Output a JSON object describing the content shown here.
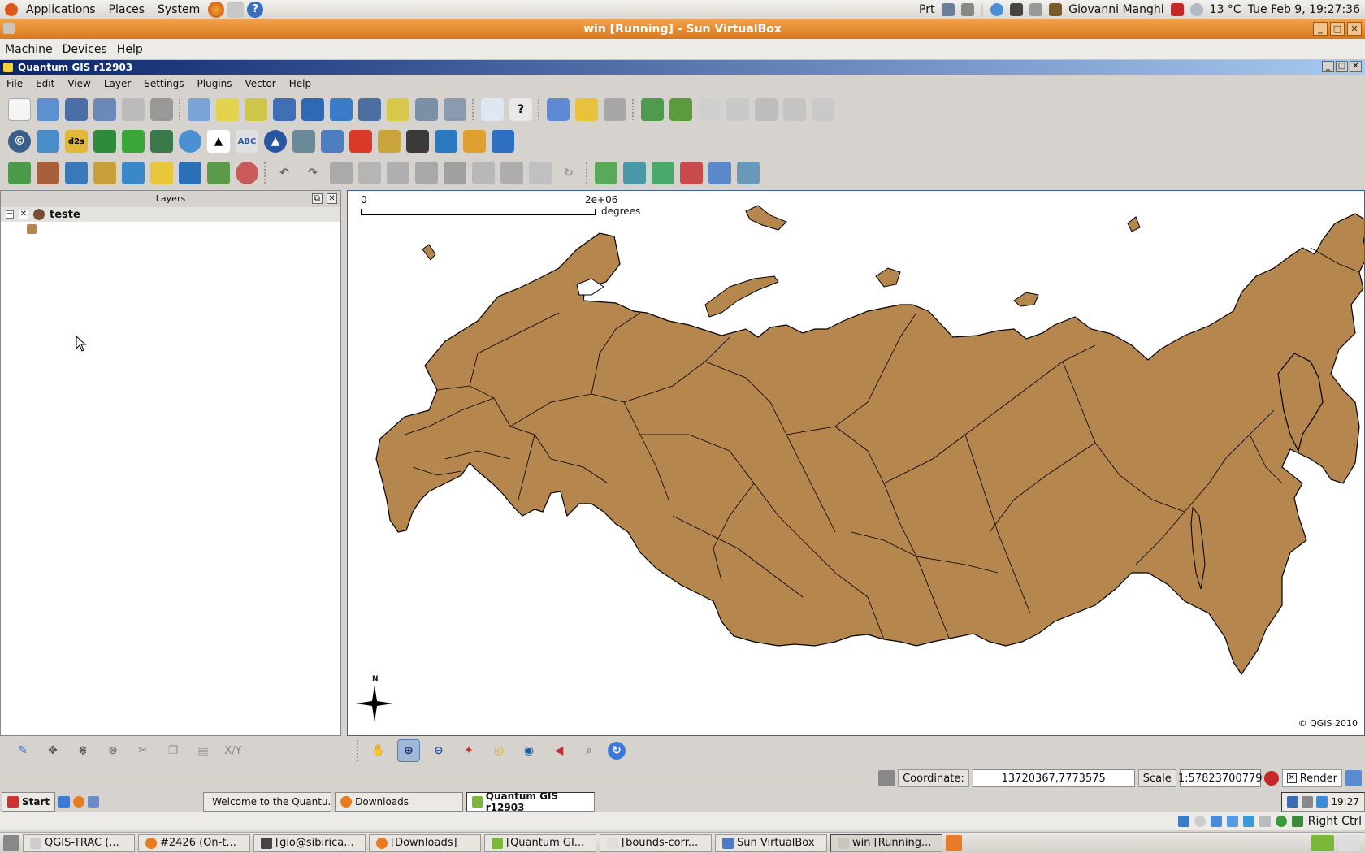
{
  "gnome_top": {
    "menus": [
      "Applications",
      "Places",
      "System"
    ],
    "prt": "Prt",
    "user": "Giovanni Manghi",
    "weather": "13 °C",
    "clock": "Tue Feb  9, 19:27:36"
  },
  "vbox": {
    "title": "win [Running] - Sun VirtualBox",
    "menus": [
      "Machine",
      "Devices",
      "Help"
    ],
    "host_key": "Right Ctrl"
  },
  "qgis": {
    "title": "Quantum GIS r12903",
    "menus": [
      "File",
      "Edit",
      "View",
      "Layer",
      "Settings",
      "Plugins",
      "Vector",
      "Help"
    ],
    "layers_panel_title": "Layers",
    "layer_name": "teste",
    "scalebar_left": "0",
    "scalebar_right": "2e+06",
    "scalebar_unit": "degrees",
    "north_label": "N",
    "copyright": "© QGIS 2010",
    "xy_label": "X/Y",
    "status": {
      "coordinate_label": "Coordinate:",
      "coordinate_value": "13720367,7773575",
      "scale_label": "Scale",
      "scale_value": "1:57823700779",
      "render_label": "Render"
    }
  },
  "win_taskbar": {
    "start": "Start",
    "items": [
      "Welcome to the Quantu...",
      "Downloads",
      "Quantum GIS r12903"
    ],
    "clock": "19:27"
  },
  "gnome_bottom": {
    "items": [
      "QGIS-TRAC (...",
      "#2426 (On-t...",
      "[gio@sibirica...",
      "[Downloads]",
      "[Quantum GI...",
      "[bounds-corr...",
      "Sun VirtualBox",
      "win [Running..."
    ]
  },
  "colors": {
    "map_fill": "#b5864d",
    "vbox_title": "#e08a2c",
    "qgis_title": "#0a246a"
  }
}
